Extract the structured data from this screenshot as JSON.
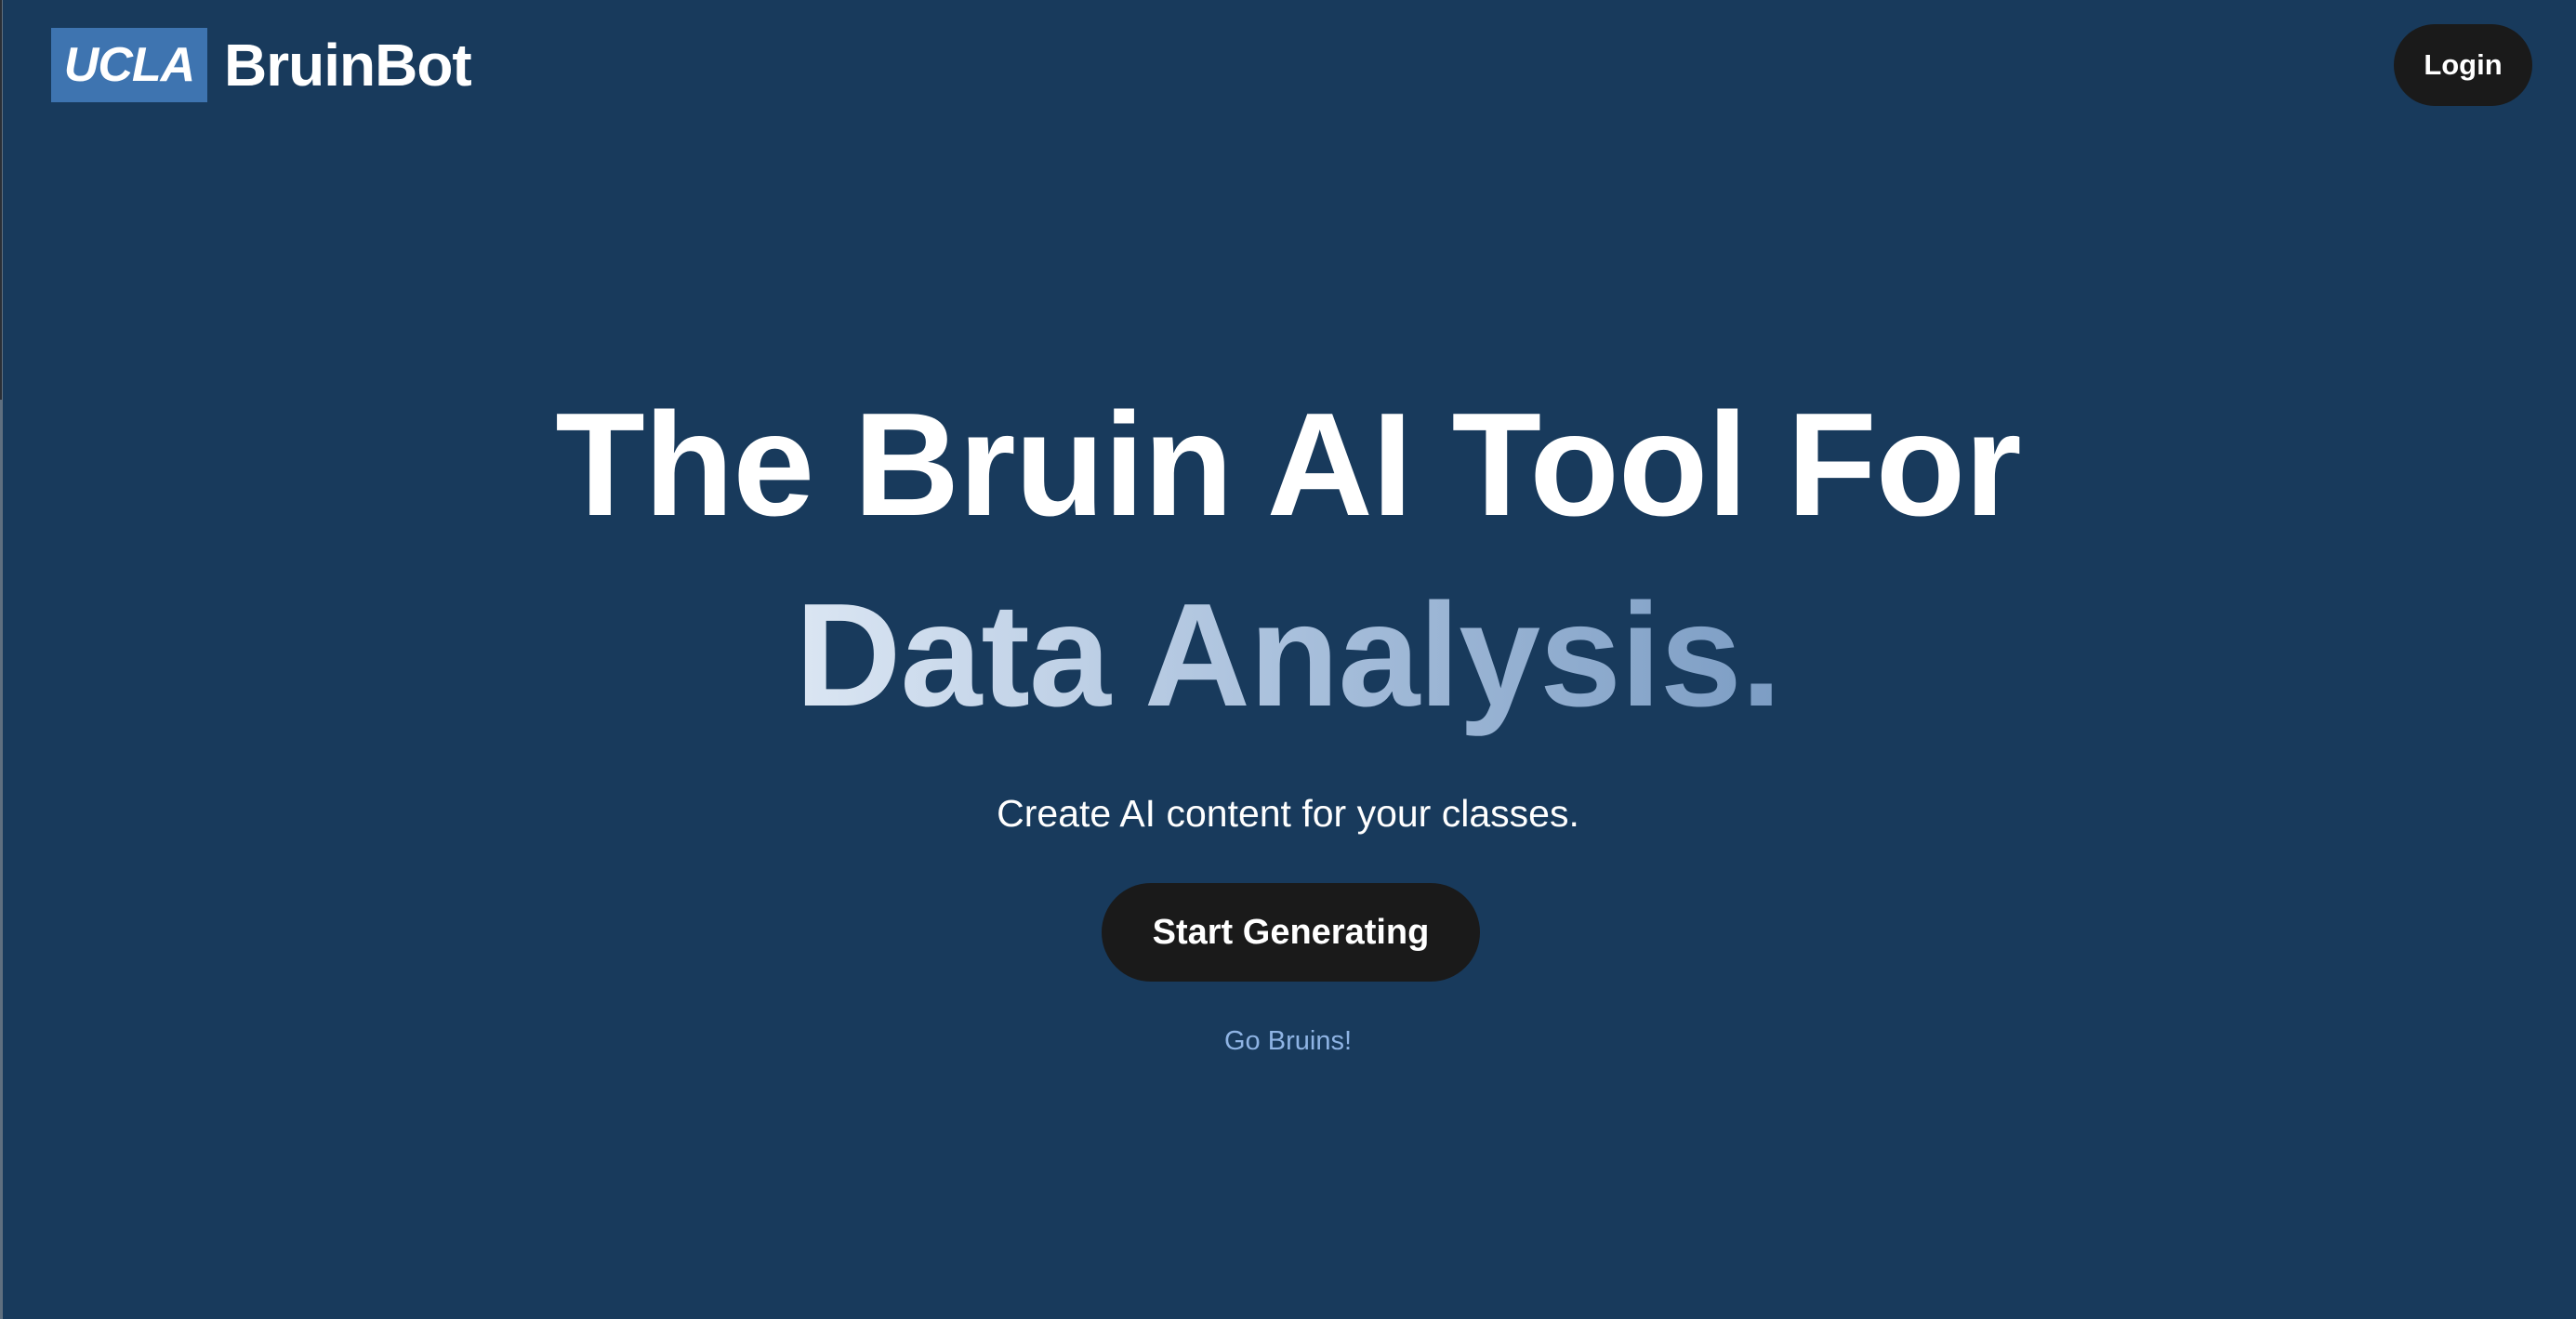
{
  "header": {
    "logo_badge": "UCLA",
    "logo_text": "BruinBot",
    "login_label": "Login"
  },
  "hero": {
    "line1": "The Bruin AI Tool For",
    "line2": "Data Analysis.",
    "subtitle": "Create AI content for your classes.",
    "cta_label": "Start Generating",
    "tagline": "Go Bruins!"
  },
  "colors": {
    "background": "#183a5c",
    "brand_badge": "#3e74b0",
    "button": "#1a1a1a",
    "accent_link": "#8fb4e4"
  }
}
